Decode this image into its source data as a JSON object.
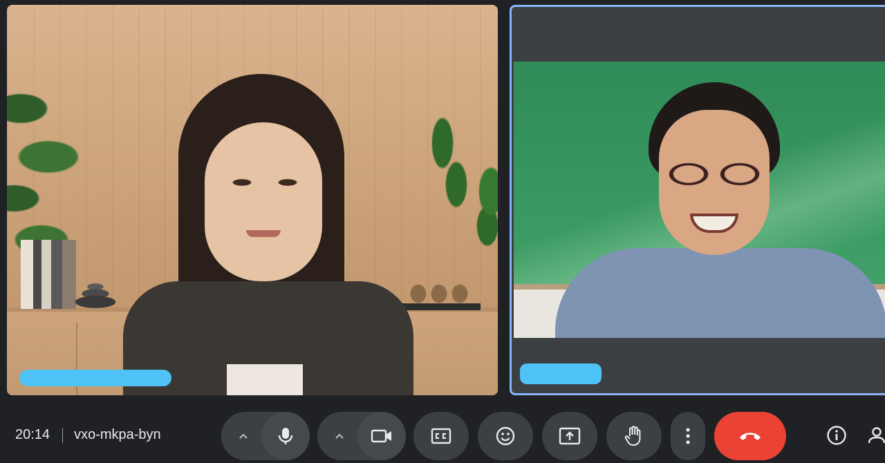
{
  "meeting": {
    "time": "20:14",
    "code": "vxo-mkpa-byn"
  },
  "participants": [
    {
      "name_tag": ""
    },
    {
      "name_tag": ""
    }
  ],
  "colors": {
    "background": "#202124",
    "control": "#3c4043",
    "end_call": "#ea4335",
    "active_speaker_border": "#8ab4f8",
    "name_tag_redaction": "#4fc3f7"
  },
  "controls": {
    "items": [
      {
        "icon": "chevron-up-icon"
      },
      {
        "icon": "mic-icon"
      },
      {
        "icon": "chevron-up-icon"
      },
      {
        "icon": "camera-icon"
      },
      {
        "icon": "captions-icon"
      },
      {
        "icon": "emoji-icon"
      },
      {
        "icon": "present-screen-icon"
      },
      {
        "icon": "raise-hand-icon"
      },
      {
        "icon": "more-options-icon"
      },
      {
        "icon": "end-call-icon"
      },
      {
        "icon": "info-icon"
      },
      {
        "icon": "people-icon"
      }
    ]
  }
}
